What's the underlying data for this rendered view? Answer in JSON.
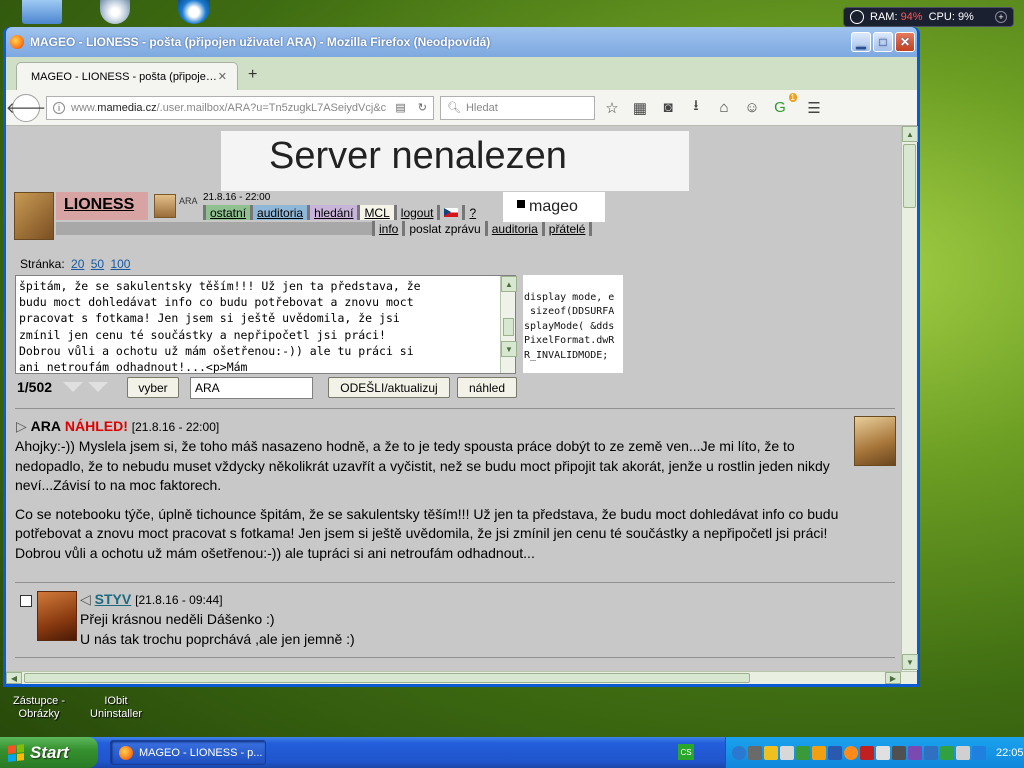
{
  "sysmon": {
    "ram_label": "RAM:",
    "ram_value": "94%",
    "cpu_label": "CPU:",
    "cpu_value": "9%"
  },
  "window": {
    "title": "MAGEO - LIONESS - pošta (připojen uživatel ARA) - Mozilla Firefox (Neodpovídá)"
  },
  "tab": {
    "label": "MAGEO - LIONESS - pošta (připoje…"
  },
  "nav": {
    "url_prefix": "www.",
    "url_domain": "mamedia.cz",
    "url_rest": "/.user.mailbox/ARA?u=Tn5zugkL7ASeiydVcj&c",
    "search_placeholder": "Hledat",
    "badge": "1"
  },
  "page": {
    "server_not_found": "Server nenalezen",
    "lioness": "LIONESS",
    "ara_small": "ARA",
    "datetime": "21.8.16 - 22:00",
    "menu1": [
      "ostatní",
      "auditoria",
      "hledání",
      "MCL",
      "logout",
      "?"
    ],
    "menu2": [
      "info",
      "poslat zprávu",
      "auditoria",
      "přátelé"
    ],
    "mageo": "mageo",
    "pages_label": "Stránka:",
    "pages": [
      "20",
      "50",
      "100"
    ],
    "compose_text": "špitám, že se sakulentsky těším!!! Už jen ta představa, že\nbudu moct dohledávat info co budu potřebovat a znovu moct\npracovat s fotkama! Jen jsem si ještě uvědomila, že jsi\nzmínil jen cenu té součástky a nepřipočetl jsi práci!\nDobrou vůli a ochotu už mám ošetřenou:-)) ale tu práci si\nani netroufám odhadnout!...<p>Mám",
    "code_text": "display mode, e\n sizeof(DDSURFA\nsplayMode( &dds\nPixelFormat.dwR\nR_INVALIDMODE;",
    "counter": "1/502",
    "vyber": "vyber",
    "recipient": "ARA",
    "send": "ODEŠLI/aktualizuj",
    "preview": "náhled",
    "post1": {
      "name": "ARA",
      "tag": "NÁHLED!",
      "date": "[21.8.16 - 22:00]",
      "para1": "Ahojky:-)) Myslela jsem si, že toho máš nasazeno hodně, a že to je tedy spousta práce dobýt to ze země ven...Je mi líto, že to nedopadlo, že to nebudu muset vždycky několikrát uzavřít a vyčistit, než se budu moct připojit tak akorát, jenže u rostlin jeden nikdy neví...Závisí to na moc faktorech.",
      "para2": "Co se notebooku týče, úplně tichounce špitám, že se sakulentsky těším!!! Už jen ta představa, že budu moct dohledávat info co budu potřebovat a znovu moct pracovat s fotkama! Jen jsem si ještě uvědomila, že jsi zmínil jen cenu té součástky a nepřipočetl jsi práci! Dobrou vůli a ochotu už mám ošetřenou:-)) ale tupráci si ani netroufám odhadnout..."
    },
    "post2": {
      "name": "STYV",
      "date": "[21.8.16 - 09:44]",
      "line1": "Přeji krásnou neděli Dášenko :)",
      "line2": "U nás tak trochu poprchává ,ale jen jemně :)"
    }
  },
  "desktop": {
    "icon1": "Zástupce - Obrázky",
    "icon2": "IObit Uninstaller"
  },
  "taskbar": {
    "start": "Start",
    "task": "MAGEO - LIONESS - p...",
    "lang": "CS",
    "clock": "22:05"
  }
}
